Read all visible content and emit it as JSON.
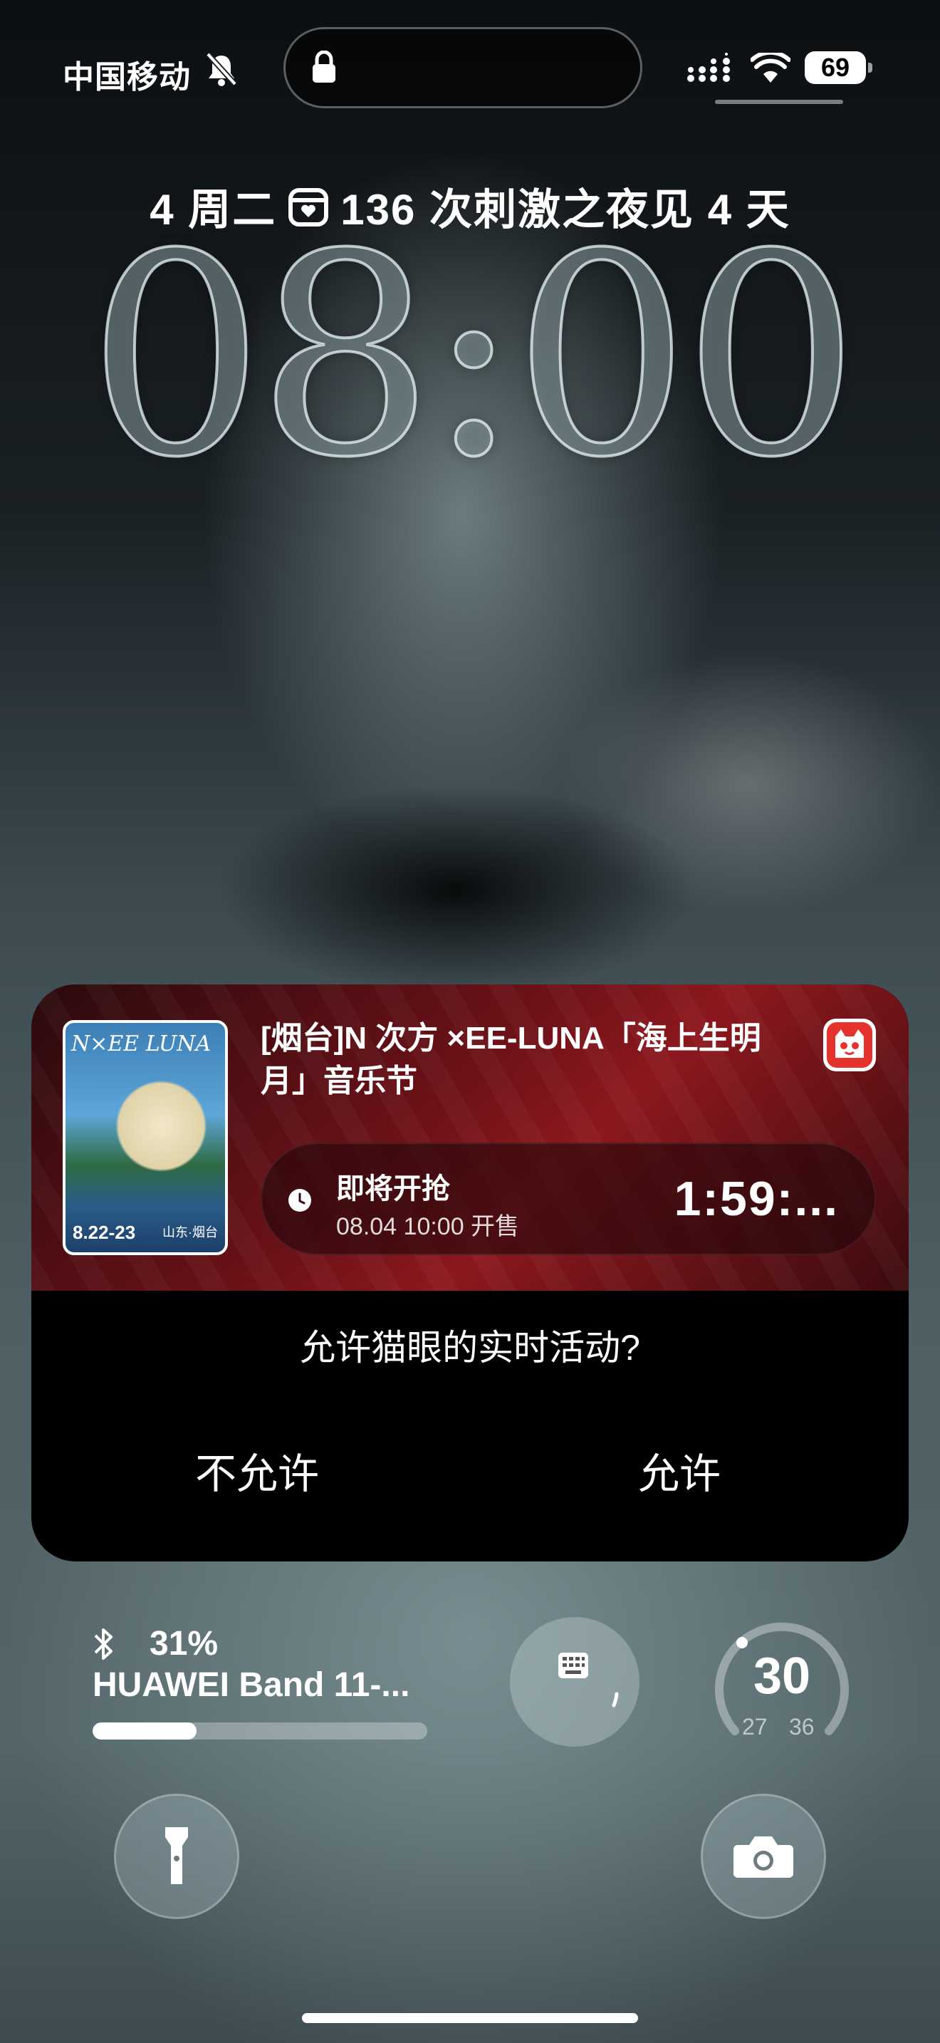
{
  "status_bar": {
    "carrier": "中国移动",
    "battery": "69"
  },
  "lock_screen": {
    "date_line": "4 周二",
    "event_line": "136 次刺激之夜见 4 天",
    "time": "08:00"
  },
  "live_activity": {
    "title": "[烟台]N 次方 ×EE-LUNA「海上生明月」音乐节",
    "poster_brand": "N×EE LUNA",
    "poster_date": "8.22-23",
    "poster_location": "山东·烟台",
    "status_label": "即将开抢",
    "sale_time": "08.04 10:00 开售",
    "countdown": "1:59:...",
    "accent_color": "#e5322c"
  },
  "permission_prompt": {
    "question": "允许猫眼的实时活动?",
    "deny_label": "不允许",
    "allow_label": "允许"
  },
  "widgets": {
    "bluetooth": {
      "battery_percent_label": "31%",
      "battery_fraction": 0.31,
      "device_name": "HUAWEI Band 11-..."
    },
    "weather": {
      "current": "30",
      "low": "27",
      "high": "36"
    }
  },
  "icons": [
    "bell-off-icon",
    "lock-icon",
    "signal-icon",
    "wifi-icon",
    "battery-icon",
    "calendar-icon",
    "clock-icon",
    "bluetooth-icon",
    "calculator-icon",
    "flashlight-icon",
    "camera-icon",
    "app-icon"
  ]
}
